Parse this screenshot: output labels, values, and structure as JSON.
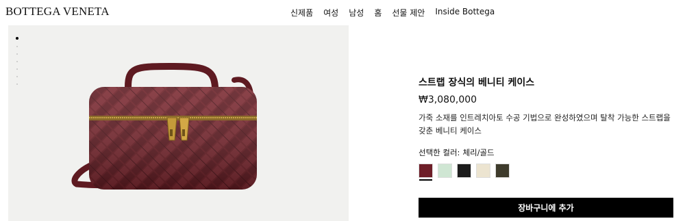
{
  "header": {
    "logo": "BOTTEGA VENETA",
    "nav": [
      "신제품",
      "여성",
      "남성",
      "홈",
      "선물 제안",
      "Inside Bottega"
    ]
  },
  "gallery": {
    "dots": 7,
    "active_index": 0
  },
  "product": {
    "title": "스트랩 장식의 베니티 케이스",
    "price": "₩3,080,000",
    "description": "가죽 소재를 인트레치아토 수공 기법으로 완성하였으며 탈착 가능한 스트랩을 갖춘 베니티 케이스",
    "color_label": "선택한 컬러:",
    "selected_color": "체리/골드",
    "swatches": [
      {
        "color": "#6e1e28",
        "selected": true
      },
      {
        "color": "#cfe6d3",
        "selected": false
      },
      {
        "color": "#1c1c1c",
        "selected": false
      },
      {
        "color": "#ece4d0",
        "selected": false
      },
      {
        "color": "#3e3b2c",
        "selected": false
      }
    ],
    "add_to_cart": "장바구니에 추가"
  }
}
